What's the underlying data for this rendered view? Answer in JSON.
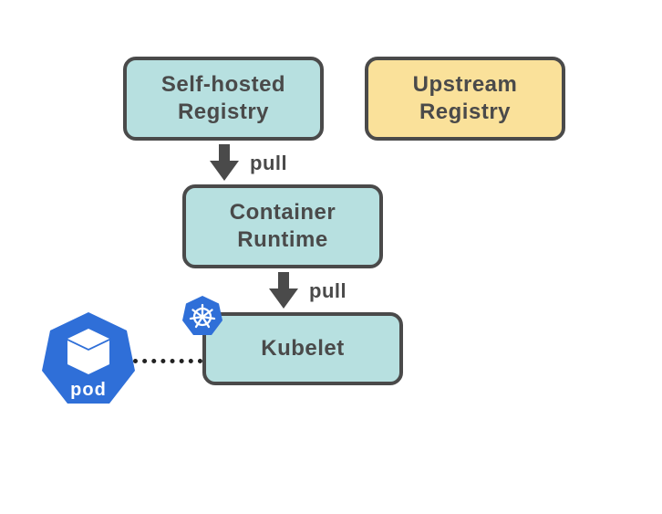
{
  "boxes": {
    "self_hosted_registry": {
      "line1": "Self-hosted",
      "line2": "Registry"
    },
    "upstream_registry": {
      "line1": "Upstream",
      "line2": "Registry"
    },
    "container_runtime": {
      "line1": "Container",
      "line2": "Runtime"
    },
    "kubelet": {
      "label": "Kubelet"
    }
  },
  "arrows": {
    "pull1": "pull",
    "pull2": "pull"
  },
  "pod": {
    "label": "pod"
  },
  "colors": {
    "teal": "#b7e0e0",
    "yellow": "#fae19a",
    "border": "#4a4a4a",
    "k8s_blue": "#2f6fd8",
    "white": "#ffffff"
  }
}
